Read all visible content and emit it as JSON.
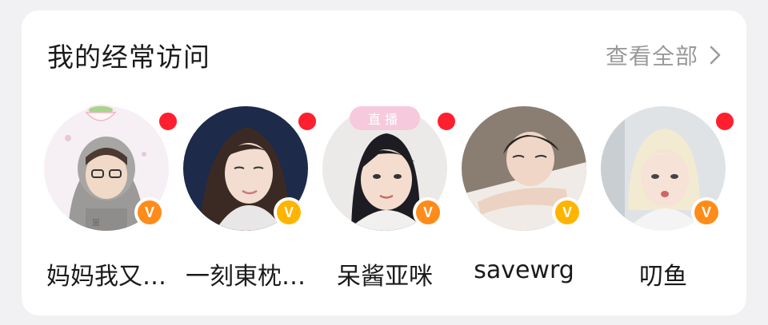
{
  "section": {
    "title": "我的经常访问",
    "view_all_label": "查看全部"
  },
  "colors": {
    "live_dot": "#ff1f2f",
    "verified_badge": "#ff8c1a",
    "live_tag": "#f7c9dc"
  },
  "users": [
    {
      "name": "妈妈我又…",
      "verified": true,
      "live_dot": true
    },
    {
      "name": "一刻東枕…",
      "verified": true,
      "live_dot": true
    },
    {
      "name": "呆酱亚咪",
      "verified": true,
      "live_dot": true,
      "live_tag": "直播"
    },
    {
      "name": "savewrg",
      "verified": true,
      "live_dot": false
    },
    {
      "name": "叨鱼",
      "verified": true,
      "live_dot": true
    }
  ],
  "badge_letter": "V"
}
